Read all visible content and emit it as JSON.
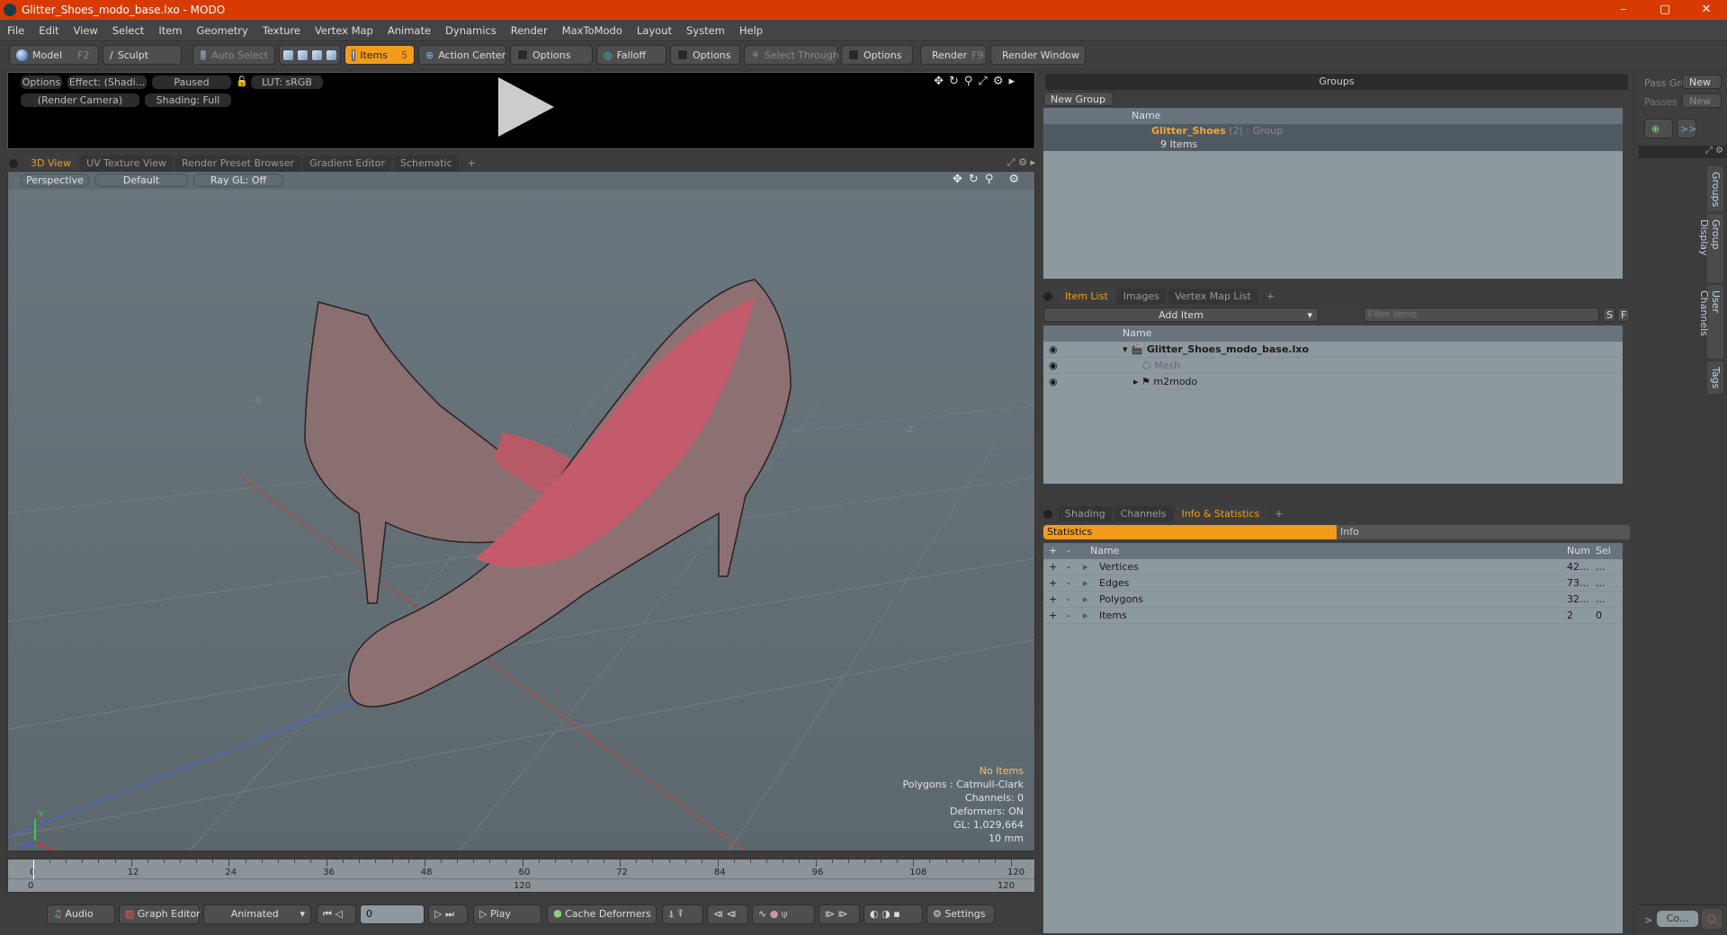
{
  "window": {
    "title": "Glitter_Shoes_modo_base.lxo - MODO",
    "controls": [
      "–",
      "▢",
      "✕"
    ]
  },
  "menu": [
    "File",
    "Edit",
    "View",
    "Select",
    "Item",
    "Geometry",
    "Texture",
    "Vertex Map",
    "Animate",
    "Dynamics",
    "Render",
    "MaxToModo",
    "Layout",
    "System",
    "Help"
  ],
  "toolbar": {
    "model": "Model",
    "model_key": "F2",
    "sculpt": "Sculpt",
    "auto_select": "Auto Select",
    "items": "Items",
    "items_key": "5",
    "action_center": "Action Center",
    "options1": "Options",
    "falloff": "Falloff",
    "options2": "Options",
    "select_through": "Select Through",
    "options3": "Options",
    "render": "Render",
    "render_key": "F9",
    "render_window": "Render Window"
  },
  "preview": {
    "options": "Options",
    "effect": "Effect: (Shadi...",
    "paused": "Paused",
    "lut": "LUT: sRGB",
    "camera": "(Render Camera)",
    "shading": "Shading: Full"
  },
  "view_tabs": [
    "3D View",
    "UV Texture View",
    "Render Preset Browser",
    "Gradient Editor",
    "Schematic",
    "+"
  ],
  "viewport": {
    "projection": "Perspective",
    "style": "Default",
    "raygl": "Ray GL: Off",
    "axis_x_label": "-X",
    "axis_z_label": "-Z",
    "info": {
      "selection": "No Items",
      "polygons": "Polygons : Catmull-Clark",
      "channels": "Channels: 0",
      "deformers": "Deformers: ON",
      "gl": "GL: 1,029,664",
      "grid": "10 mm"
    }
  },
  "timeline": {
    "ticks": [
      "0",
      "12",
      "24",
      "36",
      "48",
      "60",
      "72",
      "84",
      "96",
      "108",
      "120"
    ],
    "range_start": "0",
    "range_mid": "120",
    "range_end": "120"
  },
  "bottom": {
    "audio": "Audio",
    "graph_editor": "Graph Editor",
    "animated": "Animated",
    "frame": "0",
    "play": "Play",
    "cache_deformers": "Cache Deformers",
    "settings": "Settings"
  },
  "groups": {
    "title": "Groups",
    "new_group": "New Group",
    "col_name": "Name",
    "group_name": "Glitter_Shoes",
    "group_count": "(2)",
    "group_type": ": Group",
    "group_items": "9 Items"
  },
  "passes": {
    "pass_group": "Pass Gro",
    "passes": "Passes",
    "new1": "New",
    "new2": "New",
    "more": ">>"
  },
  "side_tabs": [
    "Groups",
    "Group Display",
    "User Channels",
    "Tags"
  ],
  "item_list": {
    "tabs": [
      "Item List",
      "Images",
      "Vertex Map List",
      "+"
    ],
    "add_item": "Add Item",
    "filter_placeholder": "Filter Items",
    "s": "S",
    "f": "F",
    "col_name": "Name",
    "items": [
      {
        "name": "Glitter_Shoes_modo_base.lxo",
        "level": 0
      },
      {
        "name": "Mesh",
        "level": 1
      },
      {
        "name": "m2modo",
        "level": 1
      }
    ]
  },
  "stats": {
    "tabs": [
      "Shading",
      "Channels",
      "Info & Statistics",
      "+"
    ],
    "statistics": "Statistics",
    "info": "Info",
    "cols": [
      "Name",
      "Num",
      "Sel"
    ],
    "rows": [
      {
        "name": "Vertices",
        "num": "42...",
        "sel": "..."
      },
      {
        "name": "Edges",
        "num": "73...",
        "sel": "..."
      },
      {
        "name": "Polygons",
        "num": "32...",
        "sel": "..."
      },
      {
        "name": "Items",
        "num": "2",
        "sel": "0"
      }
    ]
  },
  "command": {
    "prompt": ">",
    "field": "Co..."
  }
}
